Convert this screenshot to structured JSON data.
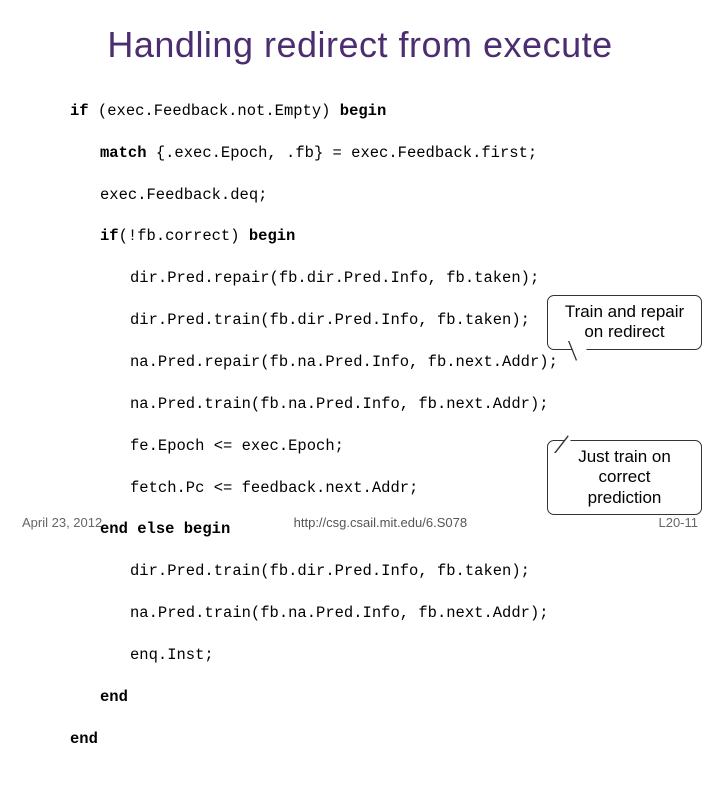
{
  "title": "Handling redirect from execute",
  "code": {
    "l1a": "if",
    "l1b": " (exec.Feedback.not.Empty) ",
    "l1c": "begin",
    "l2a": "match",
    "l2b": " {.exec.Epoch, .fb} = exec.Feedback.first;",
    "l3": "exec.Feedback.deq;",
    "l4a": "if",
    "l4b": "(!fb.correct) ",
    "l4c": "begin",
    "l5": "dir.Pred.repair(fb.dir.Pred.Info, fb.taken);",
    "l6": "dir.Pred.train(fb.dir.Pred.Info, fb.taken);",
    "l7": "na.Pred.repair(fb.na.Pred.Info, fb.next.Addr);",
    "l8": "na.Pred.train(fb.na.Pred.Info, fb.next.Addr);",
    "l9": "fe.Epoch <= exec.Epoch;",
    "l10": "fetch.Pc <= feedback.next.Addr;",
    "l11a": "end",
    "l11b": " ",
    "l11c": "else",
    "l11d": " ",
    "l11e": "begin",
    "l12": "dir.Pred.train(fb.dir.Pred.Info, fb.taken);",
    "l13": "na.Pred.train(fb.na.Pred.Info, fb.next.Addr);",
    "l14": "enq.Inst;",
    "l15": "end",
    "l16": "end"
  },
  "callouts": {
    "c1_line1": "Train and repair",
    "c1_line2": "on redirect",
    "c2_line1": "Just train on",
    "c2_line2": "correct prediction"
  },
  "footer": {
    "date": "April 23, 2012",
    "url": "http://csg.csail.mit.edu/6.S078",
    "num": "L20-11"
  }
}
